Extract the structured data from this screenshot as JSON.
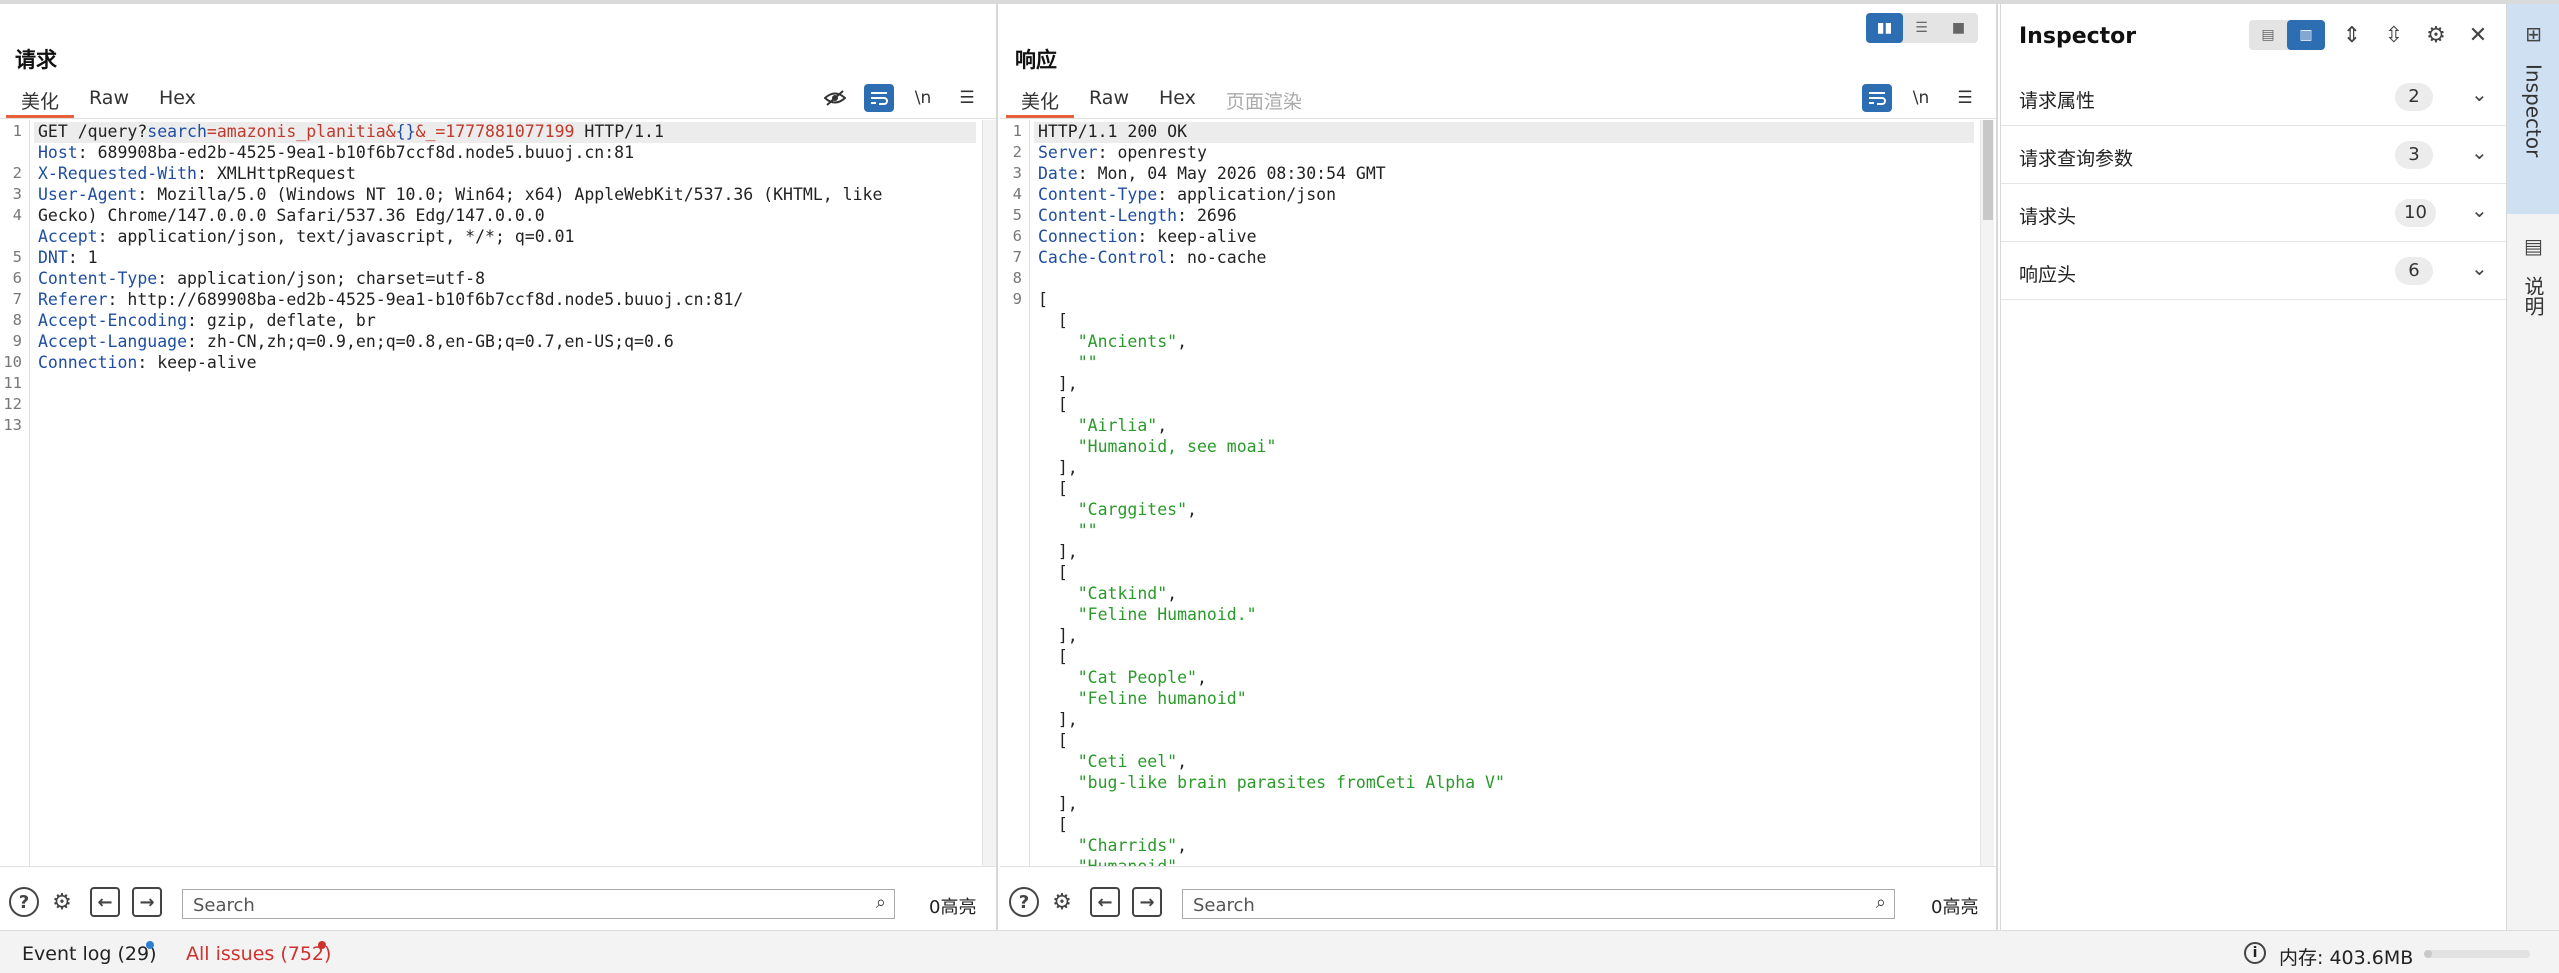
{
  "request": {
    "title": "请求",
    "tabs": [
      "美化",
      "Raw",
      "Hex"
    ],
    "lines": [
      [
        {
          "t": "GET /query?",
          "c": ""
        },
        {
          "t": "search",
          "c": "k"
        },
        {
          "t": "=amazonis_planitia&",
          "c": "s"
        },
        {
          "t": "{}",
          "c": "k"
        },
        {
          "t": "&_=1777881077199",
          "c": "s"
        },
        {
          "t": " HTTP/1.1",
          "c": ""
        }
      ],
      [
        {
          "t": "Host",
          "c": "k"
        },
        {
          "t": ": 689908ba-ed2b-4525-9ea1-b10f6b7ccf8d.node5.buuoj.cn:81",
          "c": ""
        }
      ],
      [
        {
          "t": "X-Requested-With",
          "c": "k"
        },
        {
          "t": ": XMLHttpRequest",
          "c": ""
        }
      ],
      [
        {
          "t": "User-Agent",
          "c": "k"
        },
        {
          "t": ": Mozilla/5.0 (Windows NT 10.0; Win64; x64) AppleWebKit/537.36 (KHTML, like",
          "c": ""
        }
      ],
      [
        {
          "t": "Gecko) Chrome/147.0.0.0 Safari/537.36 Edg/147.0.0.0",
          "c": ""
        }
      ],
      [
        {
          "t": "Accept",
          "c": "k"
        },
        {
          "t": ": application/json, text/javascript, */*; q=0.01",
          "c": ""
        }
      ],
      [
        {
          "t": "DNT",
          "c": "k"
        },
        {
          "t": ": 1",
          "c": ""
        }
      ],
      [
        {
          "t": "Content-Type",
          "c": "k"
        },
        {
          "t": ": application/json; charset=utf-8",
          "c": ""
        }
      ],
      [
        {
          "t": "Referer",
          "c": "k"
        },
        {
          "t": ": http://689908ba-ed2b-4525-9ea1-b10f6b7ccf8d.node5.buuoj.cn:81/",
          "c": ""
        }
      ],
      [
        {
          "t": "Accept-Encoding",
          "c": "k"
        },
        {
          "t": ": gzip, deflate, br",
          "c": ""
        }
      ],
      [
        {
          "t": "Accept-Language",
          "c": "k"
        },
        {
          "t": ": zh-CN,zh;q=0.9,en;q=0.8,en-GB;q=0.7,en-US;q=0.6",
          "c": ""
        }
      ],
      [
        {
          "t": "Connection",
          "c": "k"
        },
        {
          "t": ": keep-alive",
          "c": ""
        }
      ],
      [],
      []
    ],
    "line_numbers": [
      "1",
      "",
      "2",
      "3",
      "4",
      "",
      "5",
      "6",
      "7",
      "8",
      "9",
      "10",
      "11",
      "12",
      "13"
    ],
    "search_placeholder": "Search",
    "highlight_count": "0高亮"
  },
  "response": {
    "title": "响应",
    "tabs": [
      "美化",
      "Raw",
      "Hex",
      "页面渲染"
    ],
    "lines": [
      [
        {
          "t": "HTTP/1.1 200 OK",
          "c": ""
        }
      ],
      [
        {
          "t": "Server",
          "c": "k"
        },
        {
          "t": ": openresty",
          "c": ""
        }
      ],
      [
        {
          "t": "Date",
          "c": "k"
        },
        {
          "t": ": Mon, 04 May 2026 08:30:54 GMT",
          "c": ""
        }
      ],
      [
        {
          "t": "Content-Type",
          "c": "k"
        },
        {
          "t": ": application/json",
          "c": ""
        }
      ],
      [
        {
          "t": "Content-Length",
          "c": "k"
        },
        {
          "t": ": 2696",
          "c": ""
        }
      ],
      [
        {
          "t": "Connection",
          "c": "k"
        },
        {
          "t": ": keep-alive",
          "c": ""
        }
      ],
      [
        {
          "t": "Cache-Control",
          "c": "k"
        },
        {
          "t": ": no-cache",
          "c": ""
        }
      ],
      [],
      [
        {
          "t": "[",
          "c": ""
        }
      ],
      [
        {
          "t": "  [",
          "c": ""
        }
      ],
      [
        {
          "t": "    ",
          "c": ""
        },
        {
          "t": "\"Ancients\"",
          "c": "g"
        },
        {
          "t": ",",
          "c": ""
        }
      ],
      [
        {
          "t": "    ",
          "c": ""
        },
        {
          "t": "\"\"",
          "c": "g"
        }
      ],
      [
        {
          "t": "  ],",
          "c": ""
        }
      ],
      [
        {
          "t": "  [",
          "c": ""
        }
      ],
      [
        {
          "t": "    ",
          "c": ""
        },
        {
          "t": "\"Airlia\"",
          "c": "g"
        },
        {
          "t": ",",
          "c": ""
        }
      ],
      [
        {
          "t": "    ",
          "c": ""
        },
        {
          "t": "\"Humanoid, see moai\"",
          "c": "g"
        }
      ],
      [
        {
          "t": "  ],",
          "c": ""
        }
      ],
      [
        {
          "t": "  [",
          "c": ""
        }
      ],
      [
        {
          "t": "    ",
          "c": ""
        },
        {
          "t": "\"Carggites\"",
          "c": "g"
        },
        {
          "t": ",",
          "c": ""
        }
      ],
      [
        {
          "t": "    ",
          "c": ""
        },
        {
          "t": "\"\"",
          "c": "g"
        }
      ],
      [
        {
          "t": "  ],",
          "c": ""
        }
      ],
      [
        {
          "t": "  [",
          "c": ""
        }
      ],
      [
        {
          "t": "    ",
          "c": ""
        },
        {
          "t": "\"Catkind\"",
          "c": "g"
        },
        {
          "t": ",",
          "c": ""
        }
      ],
      [
        {
          "t": "    ",
          "c": ""
        },
        {
          "t": "\"Feline Humanoid.\"",
          "c": "g"
        }
      ],
      [
        {
          "t": "  ],",
          "c": ""
        }
      ],
      [
        {
          "t": "  [",
          "c": ""
        }
      ],
      [
        {
          "t": "    ",
          "c": ""
        },
        {
          "t": "\"Cat People\"",
          "c": "g"
        },
        {
          "t": ",",
          "c": ""
        }
      ],
      [
        {
          "t": "    ",
          "c": ""
        },
        {
          "t": "\"Feline humanoid\"",
          "c": "g"
        }
      ],
      [
        {
          "t": "  ],",
          "c": ""
        }
      ],
      [
        {
          "t": "  [",
          "c": ""
        }
      ],
      [
        {
          "t": "    ",
          "c": ""
        },
        {
          "t": "\"Ceti eel\"",
          "c": "g"
        },
        {
          "t": ",",
          "c": ""
        }
      ],
      [
        {
          "t": "    ",
          "c": ""
        },
        {
          "t": "\"bug-like brain parasites fromCeti Alpha V\"",
          "c": "g"
        }
      ],
      [
        {
          "t": "  ],",
          "c": ""
        }
      ],
      [
        {
          "t": "  [",
          "c": ""
        }
      ],
      [
        {
          "t": "    ",
          "c": ""
        },
        {
          "t": "\"Charrids\"",
          "c": "g"
        },
        {
          "t": ",",
          "c": ""
        }
      ],
      [
        {
          "t": "    ",
          "c": ""
        },
        {
          "t": "\"Humanoid\"",
          "c": "g"
        }
      ]
    ],
    "line_numbers": [
      "1",
      "2",
      "3",
      "4",
      "5",
      "6",
      "7",
      "8",
      "9"
    ],
    "search_placeholder": "Search",
    "highlight_count": "0高亮"
  },
  "inspector": {
    "title": "Inspector",
    "sections": [
      {
        "label": "请求属性",
        "count": "2"
      },
      {
        "label": "请求查询参数",
        "count": "3"
      },
      {
        "label": "请求头",
        "count": "10"
      },
      {
        "label": "响应头",
        "count": "6"
      }
    ]
  },
  "side_rail": {
    "tabs": [
      "Inspector",
      "说明"
    ]
  },
  "status_bar": {
    "event_log": "Event log (29)",
    "issues": "All issues (752)",
    "memory": "内存: 403.6MB",
    "memory_fraction": 0.07
  },
  "colors": {
    "accent": "#2d6db1",
    "tab_underline": "#e8613a",
    "issues_text": "#d0312d",
    "event_dot": "#2d7fd3",
    "issue_dot": "#d0312d",
    "header_key": "#1f4ea1",
    "param_value": "#c0392b",
    "json_string": "#2a9a2a"
  }
}
